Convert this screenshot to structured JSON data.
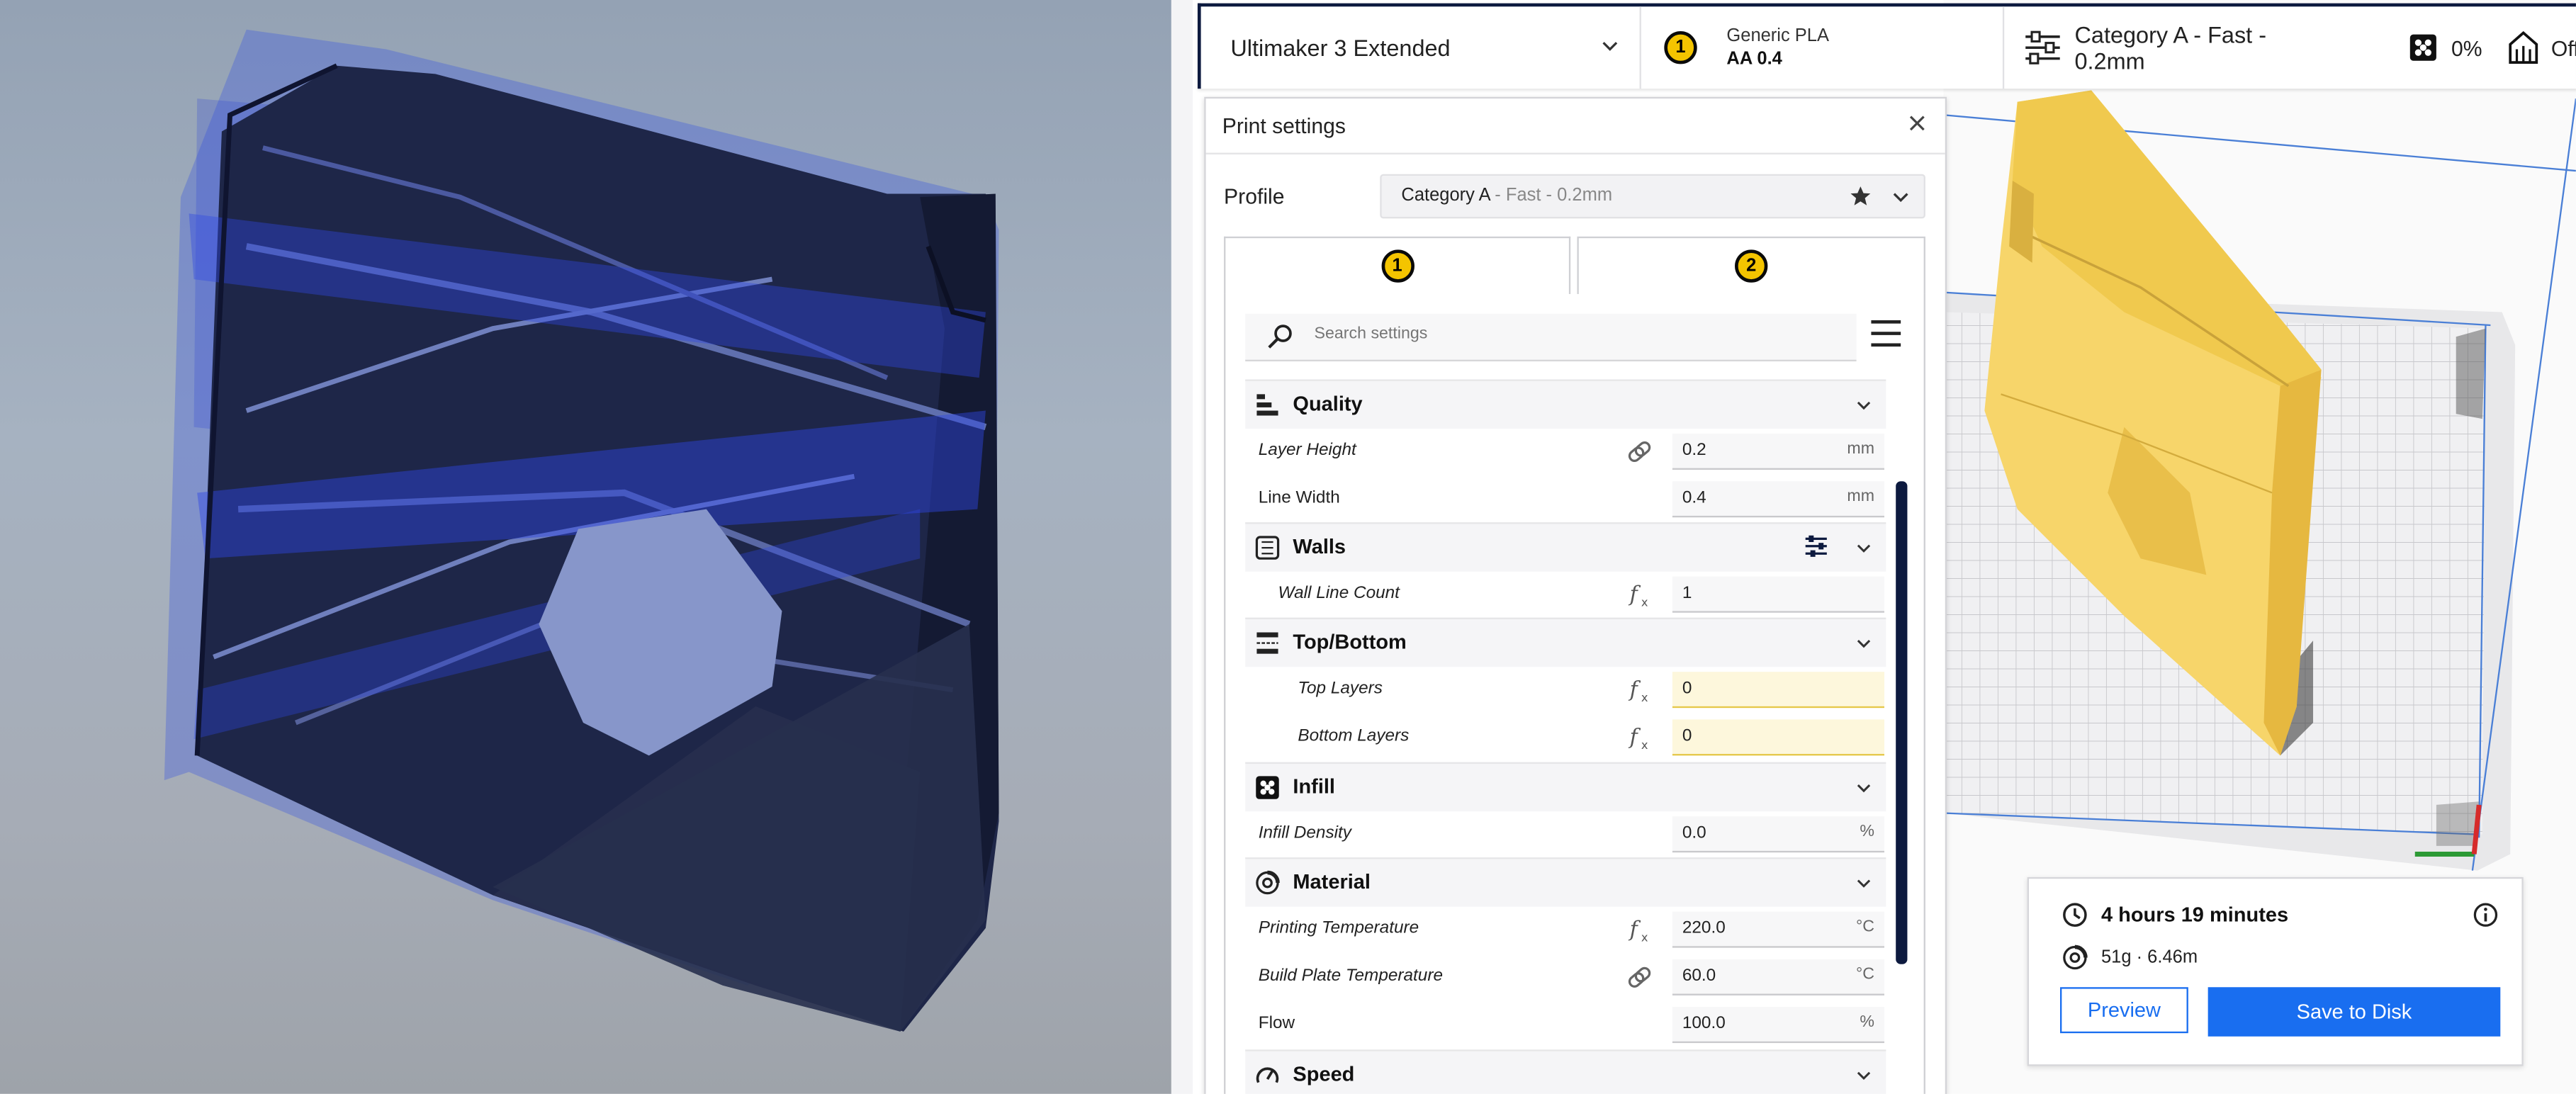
{
  "toolbar": {
    "printer": "Ultimaker 3 Extended",
    "extruder_number": "1",
    "material": "Generic PLA",
    "nozzle": "AA 0.4",
    "profile": "Category A - Fast - 0.2mm",
    "infill": "0%",
    "support": "Off"
  },
  "panel": {
    "title": "Print settings",
    "profile_label": "Profile",
    "profile_name": "Category A",
    "profile_sub": " - Fast - 0.2mm",
    "tabs": [
      {
        "label": "1"
      },
      {
        "label": "2"
      }
    ],
    "search_placeholder": "Search settings"
  },
  "settings": {
    "quality": {
      "title": "Quality"
    },
    "layer_height": {
      "label": "Layer Height",
      "value": "0.2",
      "unit": "mm"
    },
    "line_width": {
      "label": "Line Width",
      "value": "0.4",
      "unit": "mm"
    },
    "walls": {
      "title": "Walls"
    },
    "wall_line_count": {
      "label": "Wall Line Count",
      "value": "1"
    },
    "topbottom": {
      "title": "Top/Bottom"
    },
    "top_layers": {
      "label": "Top Layers",
      "value": "0"
    },
    "bottom_layers": {
      "label": "Bottom Layers",
      "value": "0"
    },
    "infill": {
      "title": "Infill"
    },
    "infill_density": {
      "label": "Infill Density",
      "value": "0.0",
      "unit": "%"
    },
    "material": {
      "title": "Material"
    },
    "printing_temperature": {
      "label": "Printing Temperature",
      "value": "220.0",
      "unit": "°C"
    },
    "build_plate_temperature": {
      "label": "Build Plate Temperature",
      "value": "60.0",
      "unit": "°C"
    },
    "flow": {
      "label": "Flow",
      "value": "100.0",
      "unit": "%"
    },
    "speed": {
      "title": "Speed"
    }
  },
  "summary": {
    "time": "4 hours 19 minutes",
    "material_usage": "51g · 6.46m",
    "preview_label": "Preview",
    "save_label": "Save to Disk"
  },
  "colors": {
    "accent": "#196ef0",
    "navy": "#0d1a3f",
    "model_yellow": "#f7d56a",
    "warning_field": "#fdf7dc",
    "extruder_badge": "#f4c400"
  },
  "icons": [
    "chevron-down-icon",
    "close-icon",
    "star-icon",
    "search-icon",
    "menu-icon",
    "link-icon",
    "function-icon",
    "quality-icon",
    "walls-icon",
    "topbottom-icon",
    "infill-icon",
    "material-icon",
    "speed-icon",
    "settings-sliders-icon",
    "clock-icon",
    "spool-icon",
    "info-icon",
    "support-icon"
  ]
}
